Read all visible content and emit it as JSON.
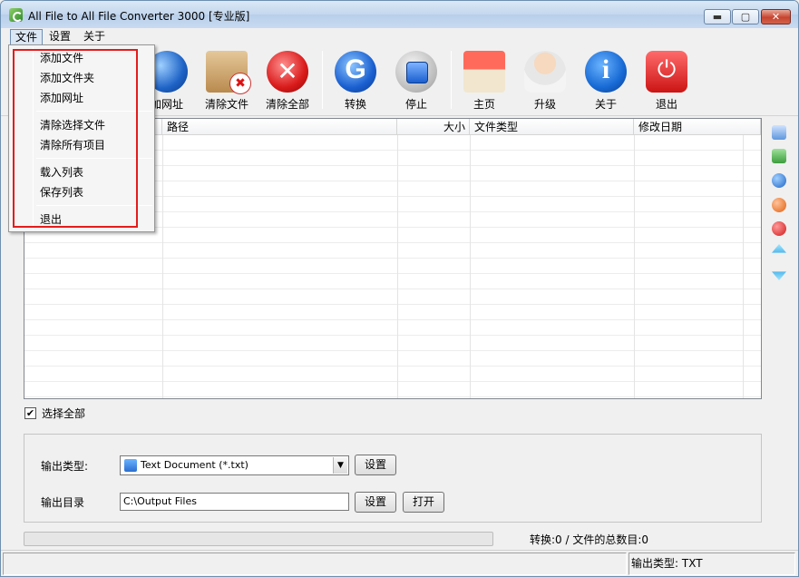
{
  "window": {
    "title": "All File to All File Converter 3000 [专业版]",
    "min_glyph": "▬",
    "max_glyph": "▢",
    "close_glyph": "✕"
  },
  "menubar": {
    "file": "文件",
    "settings": "设置",
    "about": "关于"
  },
  "file_menu": {
    "items": [
      "添加文件",
      "添加文件夹",
      "添加网址",
      "清除选择文件",
      "清除所有项目",
      "载入列表",
      "保存列表",
      "退出"
    ]
  },
  "toolbar": {
    "add_url": "加网址",
    "clear_files": "清除文件",
    "clear_all": "清除全部",
    "convert": "转换",
    "stop": "停止",
    "home": "主页",
    "upgrade": "升级",
    "about": "关于",
    "exit": "退出"
  },
  "file_list": {
    "columns": {
      "path": "路径",
      "size": "大小",
      "type": "文件类型",
      "modified": "修改日期"
    },
    "rows": []
  },
  "select_all": {
    "label": "选择全部",
    "checked": true,
    "mark": "✔"
  },
  "output": {
    "type_label": "输出类型:",
    "type_value": "Text Document (*.txt)",
    "type_arrow": "▼",
    "dir_label": "输出目录",
    "dir_value": "C:\\Output Files",
    "settings_button": "设置",
    "dir_settings_button": "设置",
    "open_button": "打开"
  },
  "progress": {
    "fraction": 0.0
  },
  "convert_status": "转换:0 / 文件的总数目:0",
  "statusbar": {
    "output_type": "输出类型: TXT"
  },
  "colors": {
    "highlight": "#e41c1c",
    "progress": "#37c33f"
  },
  "side_icons": [
    "list-icon",
    "add-folder-icon",
    "globe-icon",
    "remove-icon",
    "clear-icon",
    "move-up-icon",
    "move-down-icon"
  ]
}
